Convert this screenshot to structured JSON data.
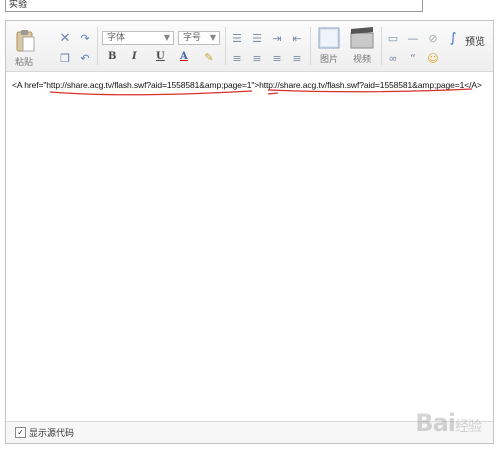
{
  "title_field": {
    "value": "实验"
  },
  "toolbar": {
    "paste_label": "粘贴",
    "font_family": "字体",
    "font_size": "字号",
    "bold": "B",
    "italic": "I",
    "underline": "U",
    "font_color": "A",
    "image_label": "图片",
    "video_label": "视频",
    "preview_label": "预览"
  },
  "editor": {
    "code_prefix": "<A href=\"",
    "code_url": "http://share.acg.tv/flash.swf?aid=1558581&amp;page=1",
    "code_mid": "\">",
    "code_text": "http://share.acg.tv/flash.swf?aid=1558581&amp;page=1",
    "code_suffix": "</A>"
  },
  "footer": {
    "checkbox_checked": "✓",
    "label": "显示源代码"
  },
  "watermark": {
    "text": "Bai",
    "suffix": "经验"
  },
  "colors": {
    "accent": "#5a7db8",
    "annotation": "#d9302c"
  }
}
